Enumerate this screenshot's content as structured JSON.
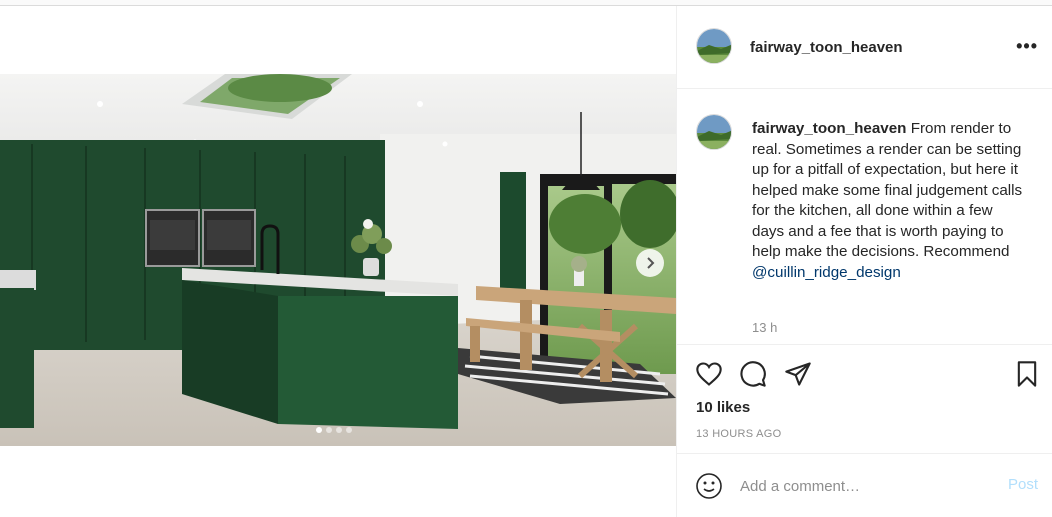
{
  "post": {
    "username": "fairway_toon_heaven",
    "more_glyph": "•••",
    "caption_text": "From render to real. Sometimes a render can be setting up for a pitfall of expectation, but here it helped make some final judgement calls for the kitchen, all done within a few days and a fee that is worth paying to help make the decisions. Recommend",
    "caption_mention": "@cuillin_ridge_design",
    "caption_time": "13 h",
    "likes": "10 likes",
    "posted_ago": "13 HOURS AGO",
    "carousel": {
      "count": 4,
      "active": 1
    }
  },
  "comment": {
    "placeholder": "Add a comment…",
    "post_label": "Post"
  },
  "icons": {
    "more": "more-options-icon",
    "like": "heart-icon",
    "comment": "comment-icon",
    "share": "share-icon",
    "save": "bookmark-icon",
    "emoji": "emoji-icon",
    "next": "chevron-right-icon"
  },
  "colors": {
    "cabinet_green": "#1f4a2e",
    "link": "#00376b",
    "post_disabled": "#b2dffc",
    "muted": "#8e8e8e"
  }
}
